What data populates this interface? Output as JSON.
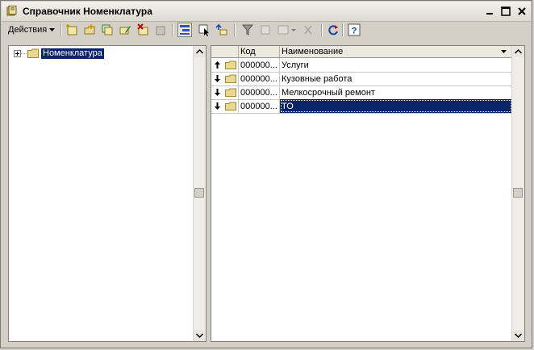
{
  "window": {
    "title": "Справочник Номенклатура"
  },
  "toolbar": {
    "actions_label": "Действия"
  },
  "tree": {
    "root_label": "Номенклатура"
  },
  "grid": {
    "columns": [
      "Код",
      "Наименование"
    ],
    "rows": [
      {
        "code": "000000...",
        "name": "Услуги",
        "marker": "up"
      },
      {
        "code": "000000...",
        "name": "Кузовные работа",
        "marker": "down"
      },
      {
        "code": "000000...",
        "name": "Мелкосрочный ремонт",
        "marker": "down"
      },
      {
        "code": "000000...",
        "name": "ТО",
        "marker": "down",
        "selected": true
      }
    ]
  },
  "colors": {
    "selection": "#0a246a",
    "folder": "#e8d892",
    "panel": "#d4d0c8"
  }
}
